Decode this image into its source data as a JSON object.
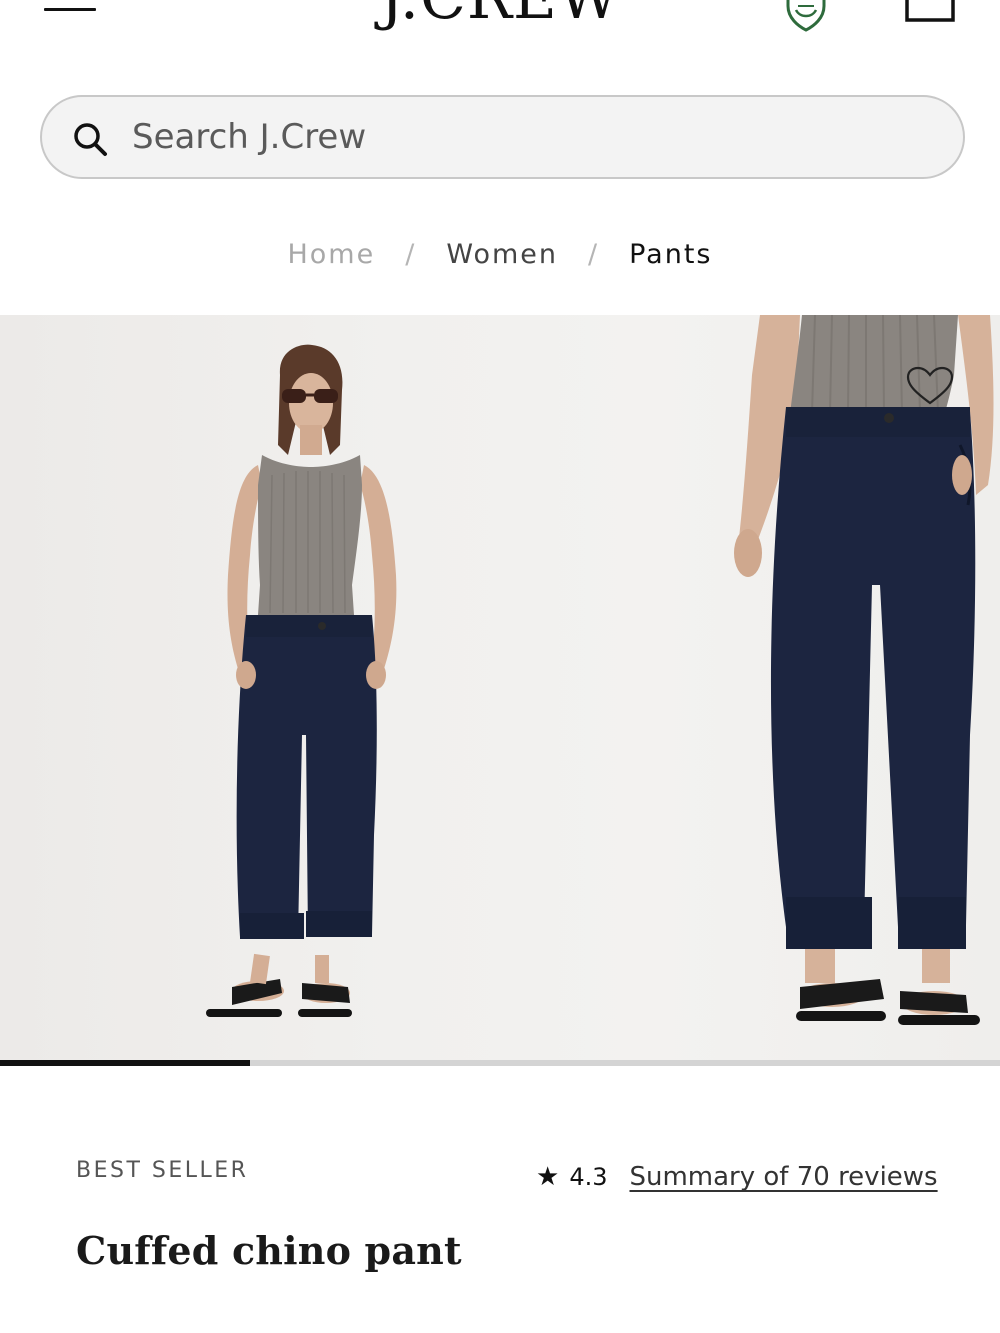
{
  "header": {
    "logo_text": "J.CREW",
    "menu_icon": "hamburger-menu-icon",
    "account_icon": "shield-account-icon",
    "bag_icon": "shopping-bag-icon",
    "account_icon_color": "#2e6b3c"
  },
  "search": {
    "placeholder": "Search J.Crew",
    "value": "",
    "icon": "search-icon"
  },
  "breadcrumb": {
    "items": [
      "Home",
      "Women",
      "Pants"
    ],
    "separator": "/"
  },
  "gallery": {
    "images": [
      "model-full-body-front-view",
      "model-waist-down-close-up"
    ],
    "wishlist_icon": "heart-outline-icon",
    "progress_fraction": 0.25,
    "pant_color": "#1c2540",
    "top_color": "#8a8580"
  },
  "product": {
    "badge": "BEST SELLER",
    "rating_icon": "star-icon",
    "rating": "4.3",
    "reviews_link": "Summary of 70 reviews",
    "title": "Cuffed chino pant"
  }
}
